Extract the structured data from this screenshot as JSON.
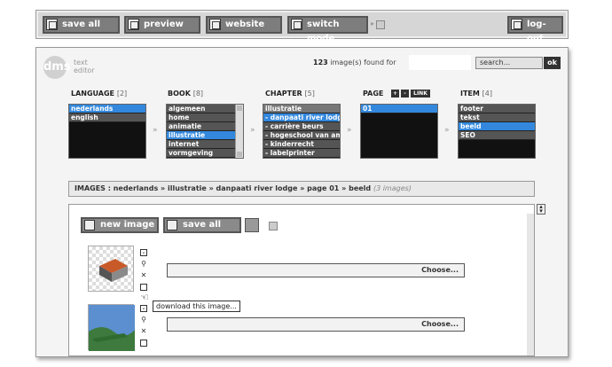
{
  "toolbar": {
    "save_all": "save all",
    "preview": "preview",
    "website": "website",
    "switch_mode": "switch mode",
    "logout": "log-out"
  },
  "header": {
    "logo": "dms",
    "logo_text_1": "text",
    "logo_text_2": "editor",
    "found_count": "123",
    "found_text": "image(s) found for",
    "search_placeholder": "search...",
    "ok": "ok"
  },
  "columns": {
    "language": {
      "label": "LANGUAGE",
      "count": "[2]",
      "items": [
        "nederlands",
        "english"
      ],
      "selected": 0
    },
    "book": {
      "label": "BOOK",
      "count": "[8]",
      "items": [
        "algemeen",
        "home",
        "animatie",
        "illustratie",
        "internet",
        "vormgeving"
      ],
      "selected": 3
    },
    "chapter": {
      "label": "CHAPTER",
      "count": "[5]",
      "items": [
        "illustratie",
        " - danpaati river lodge",
        " - carrière beurs",
        " - hogeschool van amsterdam",
        " - kinderrecht",
        " - labelprinter"
      ],
      "selected": 1
    },
    "page": {
      "label": "PAGE",
      "plus": "+",
      "minus": "-",
      "link": "LINK",
      "items": [
        "01"
      ],
      "selected": 0
    },
    "item": {
      "label": "ITEM",
      "count": "[4]",
      "items": [
        "footer",
        "tekst",
        "beeld",
        "SEO"
      ],
      "selected": 2
    }
  },
  "breadcrumb": {
    "path": "IMAGES : nederlands » illustratie » danpaati river lodge » page 01 » beeld",
    "count": "(3 images)"
  },
  "work": {
    "new_image": "new image",
    "save_all": "save all",
    "choose_1": "Choose...",
    "choose_2": "Choose...",
    "tooltip": "download this image..."
  }
}
